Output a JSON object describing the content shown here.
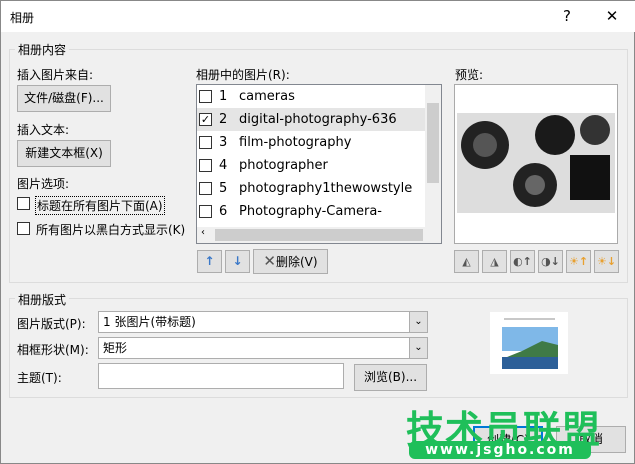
{
  "window": {
    "title": "相册",
    "help": "?",
    "close": "✕"
  },
  "content": {
    "legend": "相册内容",
    "insert_from": "插入图片来自:",
    "file_button": "文件/磁盘(F)...",
    "insert_text": "插入文本:",
    "new_textbox_button": "新建文本框(X)",
    "options_label": "图片选项:",
    "opt_caption": "标题在所有图片下面(A)",
    "opt_bw": "所有图片以黑白方式显示(K)"
  },
  "pictures": {
    "label": "相册中的图片(R):",
    "items": [
      {
        "num": "1",
        "name": "cameras",
        "checked": false
      },
      {
        "num": "2",
        "name": "digital-photography-636",
        "checked": true
      },
      {
        "num": "3",
        "name": "film-photography",
        "checked": false
      },
      {
        "num": "4",
        "name": "photographer",
        "checked": false
      },
      {
        "num": "5",
        "name": "photography1thewowstyle",
        "checked": false
      },
      {
        "num": "6",
        "name": "Photography-Camera-",
        "checked": false
      }
    ],
    "up": "↑",
    "down": "↓",
    "delete_button": "删除(V)",
    "delete_icon": "✕"
  },
  "preview": {
    "label": "预览:"
  },
  "layout": {
    "legend": "相册版式",
    "picture_layout_label": "图片版式(P):",
    "picture_layout_value": "1 张图片(带标题)",
    "frame_label": "相框形状(M):",
    "frame_value": "矩形",
    "theme_label": "主题(T):",
    "theme_value": "",
    "browse_button": "浏览(B)..."
  },
  "footer": {
    "create_button": "创建(C)",
    "cancel_button": "取消"
  },
  "watermark": {
    "text": "技术员联盟",
    "url": "www.jsgho.com",
    "color": "#1fbf5a"
  }
}
